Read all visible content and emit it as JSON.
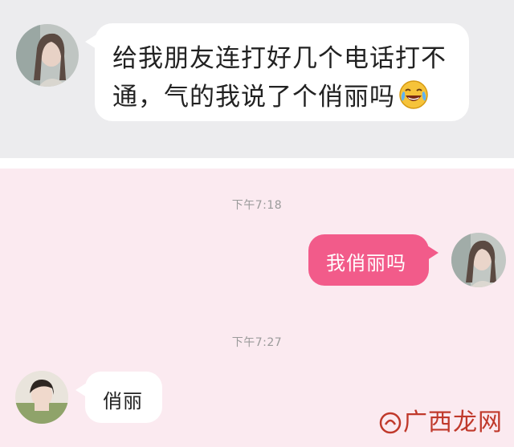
{
  "top_message": {
    "line1": "给我朋友连打好几个电话打不",
    "line2": "通，气的我说了个俏丽吗"
  },
  "conversation": [
    {
      "type": "timestamp",
      "text": "下午7:18"
    },
    {
      "type": "sent",
      "text": "我俏丽吗"
    },
    {
      "type": "timestamp",
      "text": "下午7:27"
    },
    {
      "type": "received",
      "text": "俏丽"
    }
  ],
  "watermark": {
    "text": "广西龙网"
  },
  "colors": {
    "top_background": "#ececee",
    "chat_background": "#fbeaf0",
    "sent_bubble": "#f25b8a",
    "received_bubble": "#ffffff",
    "timestamp_text": "#9b9b9b"
  },
  "icons": [
    "laughing-crying-emoji-icon",
    "watermark-logo-icon"
  ]
}
